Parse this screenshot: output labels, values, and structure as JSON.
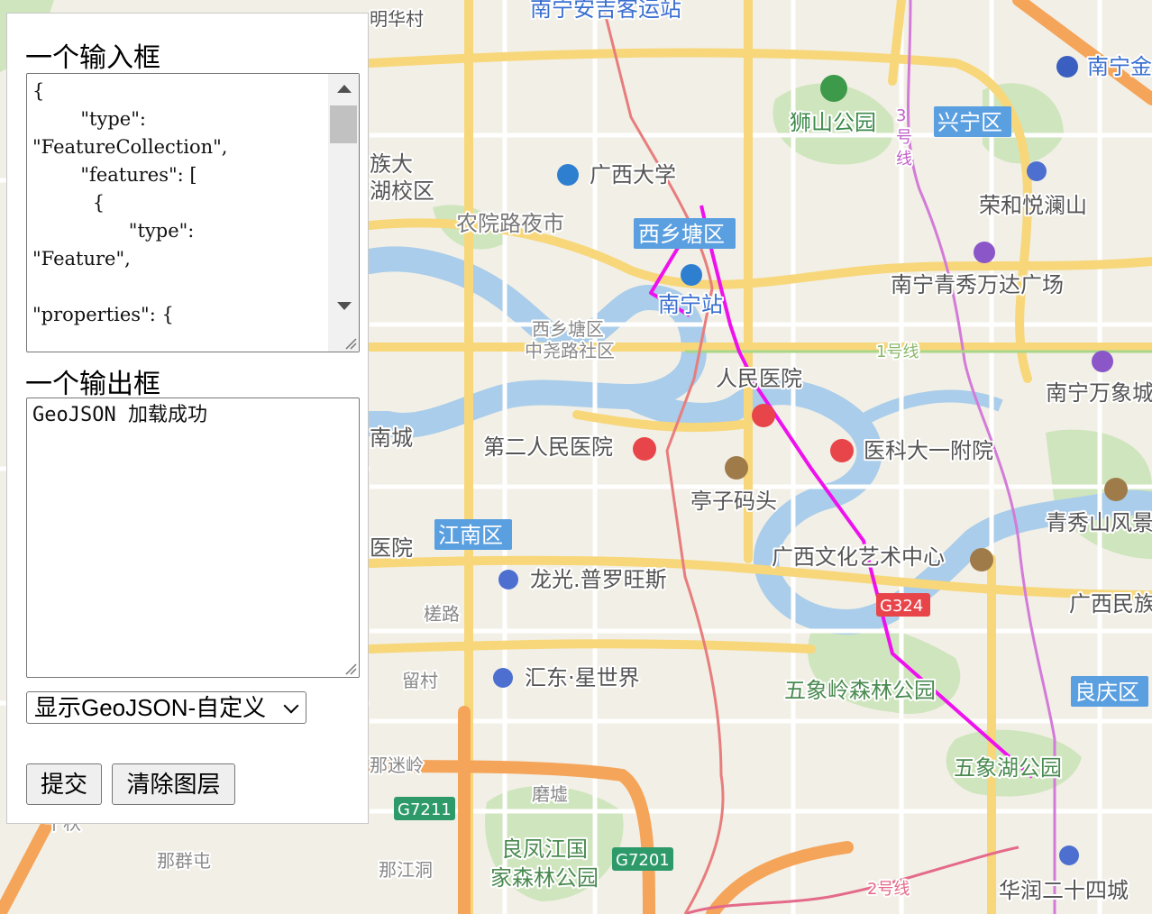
{
  "panel": {
    "input_title": "一个输入框",
    "input_value": "{\n        \"type\":\n\"FeatureCollection\",\n        \"features\": [\n          {\n                \"type\":\n\"Feature\",\n\n\"properties\": {",
    "output_title": "一个输出框",
    "output_value": "GeoJSON 加载成功",
    "select_value": "显示GeoJSON-自定义",
    "submit_label": "提交",
    "clear_label": "清除图层"
  },
  "map": {
    "labels": {
      "bus_station": "南宁安吉客运站",
      "mingcun": "明华村",
      "nanning_top_right": "南宁金",
      "shishan_park": "狮山公园",
      "xingning": "兴宁区",
      "line3_a": "3",
      "line3_b": "号",
      "line3_c": "线",
      "minzu_a": "族大",
      "minzu_b": "湖校区",
      "gxu": "广西大学",
      "ronghe": "荣和悦澜山",
      "nongyuan": "农院路夜市",
      "xixiangtang_badge": "西乡塘区",
      "nanning_station": "南宁站",
      "wanda": "南宁青秀万达广场",
      "xxt_zhongyao_a": "西乡塘区",
      "xxt_zhongyao_b": "中尧路社区",
      "line1": "1号线",
      "peoples_hospital": "人民医院",
      "mixc": "南宁万象城",
      "nancheng": "南城",
      "second_hospital": "第二人民医院",
      "medical_hospital": "医科大一附院",
      "tingzi": "亭子码头",
      "qingxiu": "青秀山风景",
      "jiangnan_badge": "江南区",
      "yuan": "医院",
      "art_center": "广西文化艺术中心",
      "longguang": "龙光.普罗旺斯",
      "g324": "G324",
      "guangxi_min": "广西民族",
      "cuolu": "槎路",
      "liucun": "留村",
      "huidong": "汇东·星世界",
      "wuxiangling": "五象岭森林公园",
      "liangqing_badge": "良庆区",
      "wuxianghu": "五象湖公园",
      "nandi": "那迷岭",
      "mojie": "磨墟",
      "g7211": "G7211",
      "liangfeng_a": "良凤江国",
      "liangfeng_b": "家森林公园",
      "g7201": "G7201",
      "naqun": "那群屯",
      "najiangdong": "那江洞",
      "line2": "2号线",
      "huarun": "华润二十四城",
      "qiu": "千秋"
    }
  },
  "colors": {
    "route_line": "#ee11ee",
    "district_badge": "#5a9fe0",
    "highway_badge": "#2e9a6a"
  }
}
